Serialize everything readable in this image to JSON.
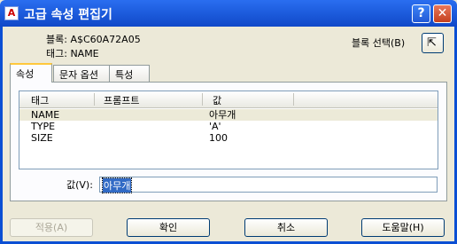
{
  "window": {
    "title": "고급 속성 편집기",
    "icon": "app-icon",
    "help": "?",
    "close": "✕"
  },
  "info": {
    "block": "블록: A$C60A72A05",
    "tag": "태그: NAME"
  },
  "select_block": {
    "label": "블록 선택(B)",
    "icon": "cursor-select-icon"
  },
  "tabs": [
    "속성",
    "문자 옵션",
    "특성"
  ],
  "list": {
    "headers": [
      "태그",
      "프롬프트",
      "값"
    ],
    "rows": [
      {
        "tag": "NAME",
        "prompt": "",
        "value": "아무개"
      },
      {
        "tag": "TYPE",
        "prompt": "",
        "value": "'A'"
      },
      {
        "tag": "SIZE",
        "prompt": "",
        "value": "100"
      }
    ]
  },
  "value_field": {
    "label": "값(V):",
    "value": "아무개"
  },
  "buttons": {
    "apply": "적용(A)",
    "ok": "확인",
    "cancel": "취소",
    "help": "도움말(H)"
  }
}
